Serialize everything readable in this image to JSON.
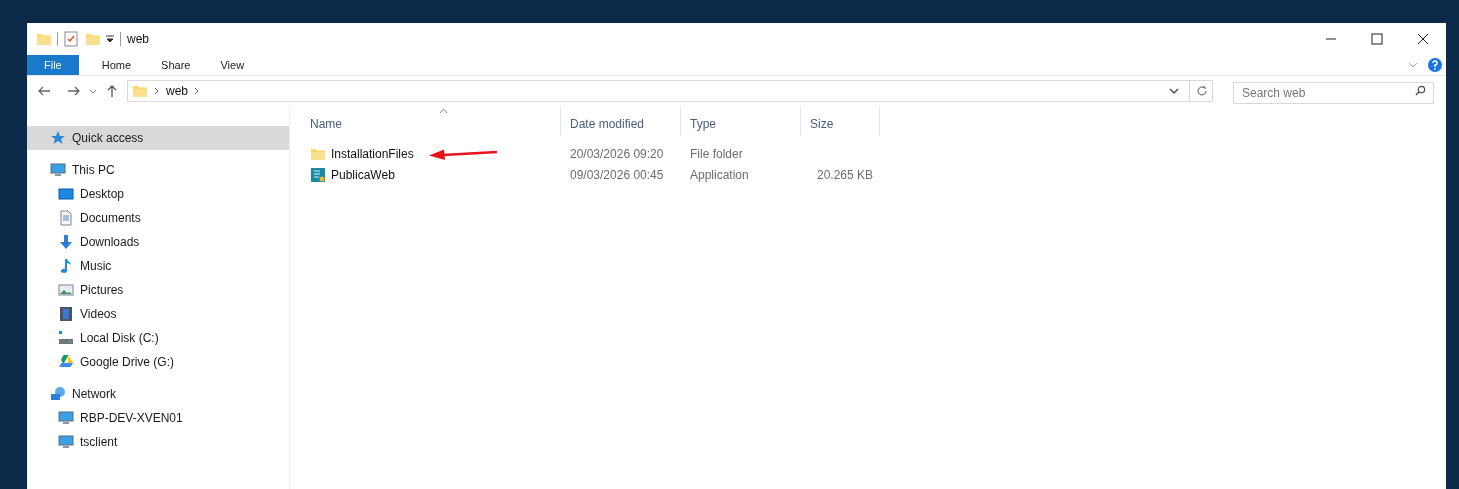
{
  "window": {
    "title": "web"
  },
  "ribbon_tabs": [
    {
      "label": "File",
      "selected": true
    },
    {
      "label": "Home",
      "selected": false
    },
    {
      "label": "Share",
      "selected": false
    },
    {
      "label": "View",
      "selected": false
    }
  ],
  "address_bar": {
    "path": [
      "web"
    ]
  },
  "search": {
    "placeholder": "Search web"
  },
  "sidebar": {
    "items": [
      {
        "label": "Quick access",
        "kind": "star",
        "selected": true
      },
      {
        "label": "This PC",
        "kind": "pc",
        "selected": false,
        "children": [
          {
            "label": "Desktop",
            "kind": "desktop",
            "selected": false
          },
          {
            "label": "Documents",
            "kind": "documents",
            "selected": false
          },
          {
            "label": "Downloads",
            "kind": "downloads",
            "selected": false
          },
          {
            "label": "Music",
            "kind": "music",
            "selected": false
          },
          {
            "label": "Pictures",
            "kind": "pictures",
            "selected": false
          },
          {
            "label": "Videos",
            "kind": "videos",
            "selected": false
          },
          {
            "label": "Local Disk (C:)",
            "kind": "disk",
            "selected": false
          },
          {
            "label": "Google Drive (G:)",
            "kind": "drive",
            "selected": false
          }
        ]
      },
      {
        "label": "Network",
        "kind": "network",
        "selected": false,
        "children": [
          {
            "label": "RBP-DEV-XVEN01",
            "kind": "pc",
            "selected": false
          },
          {
            "label": "tsclient",
            "kind": "pc",
            "selected": false
          }
        ]
      }
    ]
  },
  "table": {
    "columns": [
      "Name",
      "Date modified",
      "Type",
      "Size"
    ],
    "rows": [
      {
        "name": "InstallationFiles",
        "kind": "folder",
        "date": "20/03/2026 09:20",
        "type": "File folder",
        "size": ""
      },
      {
        "name": "PublicaWeb",
        "kind": "application",
        "date": "09/03/2026 00:45",
        "type": "Application",
        "size": "20.265 KB"
      }
    ]
  }
}
